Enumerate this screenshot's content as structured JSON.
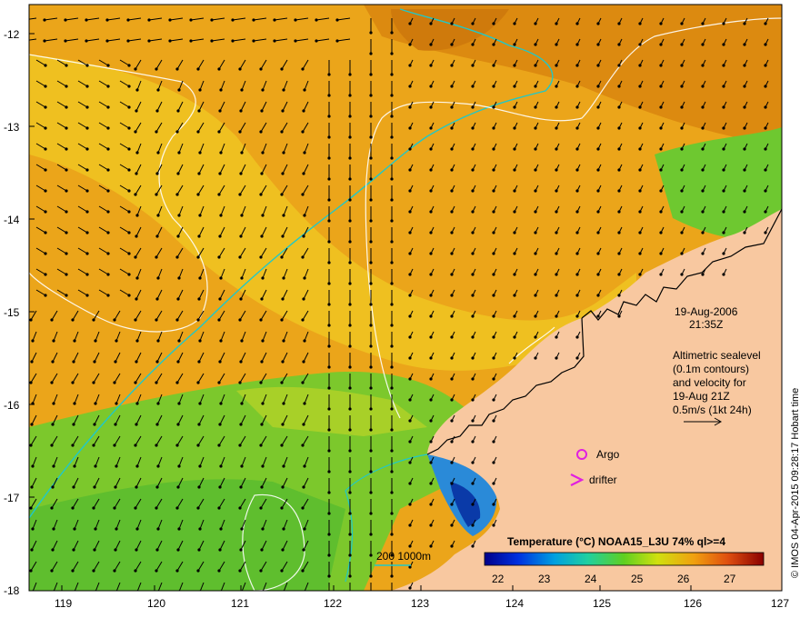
{
  "map": {
    "lon_ticks": [
      "119",
      "120",
      "121",
      "122",
      "123",
      "124",
      "125",
      "126",
      "127"
    ],
    "lat_ticks": [
      "-12",
      "-13",
      "-14",
      "-15",
      "-16",
      "-17",
      "-18"
    ],
    "date": "19-Aug-2006",
    "time": "21:35Z",
    "info_lines": [
      "Altimetric sealevel",
      "(0.1m contours)",
      "and velocity for",
      "19-Aug 21Z",
      "0.5m/s (1kt 24h)"
    ],
    "argo_label": "Argo",
    "drifter_label": "drifter",
    "bathy_label": "200  1000m",
    "legend_title": "Temperature (°C) NOAA15_L3U 74% ql>=4",
    "legend_ticks": [
      "22",
      "23",
      "24",
      "25",
      "26",
      "27"
    ],
    "credit": "© IMOS 04-Apr-2015 09:28:17 Hobart time"
  },
  "colors": {
    "land": "#f8c8a0",
    "sst_warm": "#e89a14",
    "sst_hot": "#d97a0a",
    "sst_mid": "#f0c020",
    "sst_cool": "#78c828",
    "sst_cold": "#2a8ad8",
    "bathy_line": "#20c8c8",
    "contour": "#ffffff",
    "argo": "#e020e0"
  }
}
